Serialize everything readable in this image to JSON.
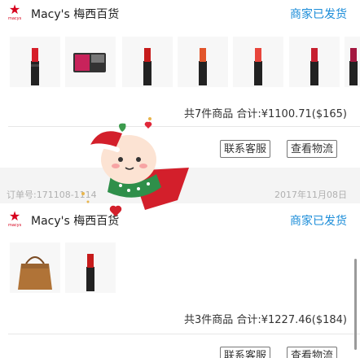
{
  "orders": [
    {
      "store_name": "Macy's 梅西百货",
      "status": "商家已发货",
      "products": [
        "red-lipstick",
        "compact-palette",
        "red-lipstick",
        "orange-lipstick",
        "coral-lipstick",
        "red-lipstick",
        "berry-lipstick"
      ],
      "summary": "共7件商品 合计:¥1100.71($165)",
      "contact_button": "联系客服",
      "logistics_button": "查看物流"
    },
    {
      "order_number": "订单号:171108-1114",
      "date": "2017年11月08日",
      "store_name": "Macy's 梅西百货",
      "status": "商家已发货",
      "products": [
        "brown-handbag",
        "red-lipstick"
      ],
      "summary": "共3件商品 合计:¥1227.46($184)",
      "contact_button": "联系客服",
      "logistics_button": "查看物流"
    }
  ],
  "colors": {
    "brand_red": "#d6001c",
    "status_blue": "#1a8cd8"
  },
  "icons": {
    "store_logo": "macys-star-icon"
  }
}
